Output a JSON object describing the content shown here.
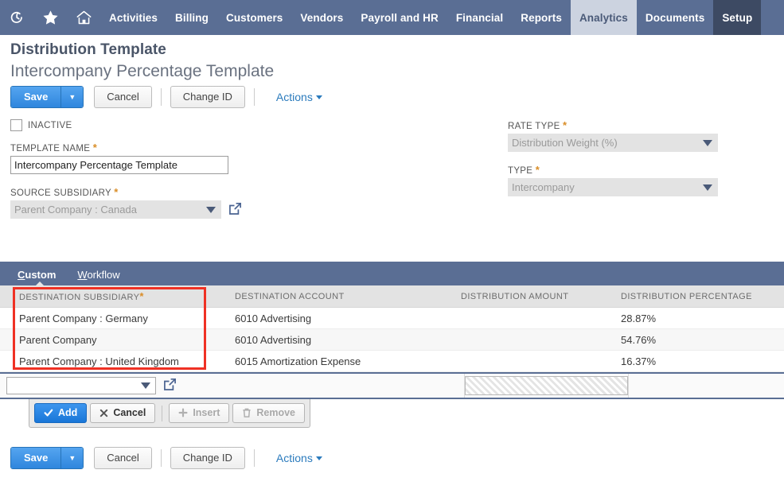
{
  "topnav": {
    "icons": [
      {
        "name": "recent-history-icon",
        "label": "Recent Records"
      },
      {
        "name": "favorites-star-icon",
        "label": "Shortcuts"
      },
      {
        "name": "home-icon",
        "label": "Home"
      }
    ],
    "items": [
      {
        "label": "Activities",
        "state": "normal"
      },
      {
        "label": "Billing",
        "state": "normal"
      },
      {
        "label": "Customers",
        "state": "normal"
      },
      {
        "label": "Vendors",
        "state": "normal"
      },
      {
        "label": "Payroll and HR",
        "state": "normal"
      },
      {
        "label": "Financial",
        "state": "normal"
      },
      {
        "label": "Reports",
        "state": "normal"
      },
      {
        "label": "Analytics",
        "state": "active"
      },
      {
        "label": "Documents",
        "state": "normal"
      },
      {
        "label": "Setup",
        "state": "dark"
      }
    ],
    "bg_color": "#5a6e94",
    "active_bg_color": "#ccd3e0",
    "dark_bg_color": "#3d4a63"
  },
  "header": {
    "page_title": "Distribution Template",
    "record_title": "Intercompany Percentage Template"
  },
  "toolbar": {
    "save_label": "Save",
    "save_arrow": "▼",
    "cancel_label": "Cancel",
    "change_id_label": "Change ID",
    "actions_label": "Actions"
  },
  "form": {
    "inactive": {
      "label": "INACTIVE",
      "checked": false
    },
    "template_name": {
      "label": "TEMPLATE NAME",
      "required": "*",
      "value": "Intercompany Percentage Template",
      "placeholder": ""
    },
    "source_subsidiary": {
      "label": "SOURCE SUBSIDIARY",
      "required": "*",
      "value": "Parent Company : Canada",
      "disabled": true
    },
    "rate_type": {
      "label": "RATE TYPE",
      "required": "*",
      "value": "Distribution Weight (%)",
      "disabled": true
    },
    "type": {
      "label": "TYPE",
      "required": "*",
      "value": "Intercompany",
      "disabled": true
    }
  },
  "sublist": {
    "tabs": [
      {
        "accesskey": "C",
        "rest": "ustom",
        "active": true
      },
      {
        "accesskey": "W",
        "rest": "orkflow",
        "active": false
      }
    ],
    "columns": [
      {
        "label": "DESTINATION SUBSIDIARY",
        "required": "*"
      },
      {
        "label": "DESTINATION ACCOUNT",
        "required": ""
      },
      {
        "label": "DISTRIBUTION AMOUNT",
        "required": ""
      },
      {
        "label": "DISTRIBUTION PERCENTAGE",
        "required": ""
      }
    ],
    "rows": [
      {
        "destination_subsidiary": "Parent Company : Germany",
        "destination_account": "6010 Advertising",
        "distribution_amount": "",
        "distribution_percentage": "28.87%"
      },
      {
        "destination_subsidiary": "Parent Company",
        "destination_account": "6010 Advertising",
        "distribution_amount": "",
        "distribution_percentage": "54.76%"
      },
      {
        "destination_subsidiary": "Parent Company : United Kingdom",
        "destination_account": "6015 Amortization Expense",
        "distribution_amount": "",
        "distribution_percentage": "16.37%"
      }
    ],
    "entry_row": {
      "destination_subsidiary_value": "",
      "destination_account_value": "",
      "distribution_amount_value": "",
      "distribution_percentage_value": ""
    },
    "actions": {
      "add_label": "Add",
      "add_icon": "check-icon",
      "cancel_label": "Cancel",
      "cancel_icon": "x-icon",
      "insert_label": "Insert",
      "insert_icon": "plus-icon",
      "insert_disabled": true,
      "remove_label": "Remove",
      "remove_icon": "trash-icon",
      "remove_disabled": true
    }
  },
  "annotation": {
    "color": "#ef3124",
    "description": "highlight around destination subsidiary column"
  }
}
